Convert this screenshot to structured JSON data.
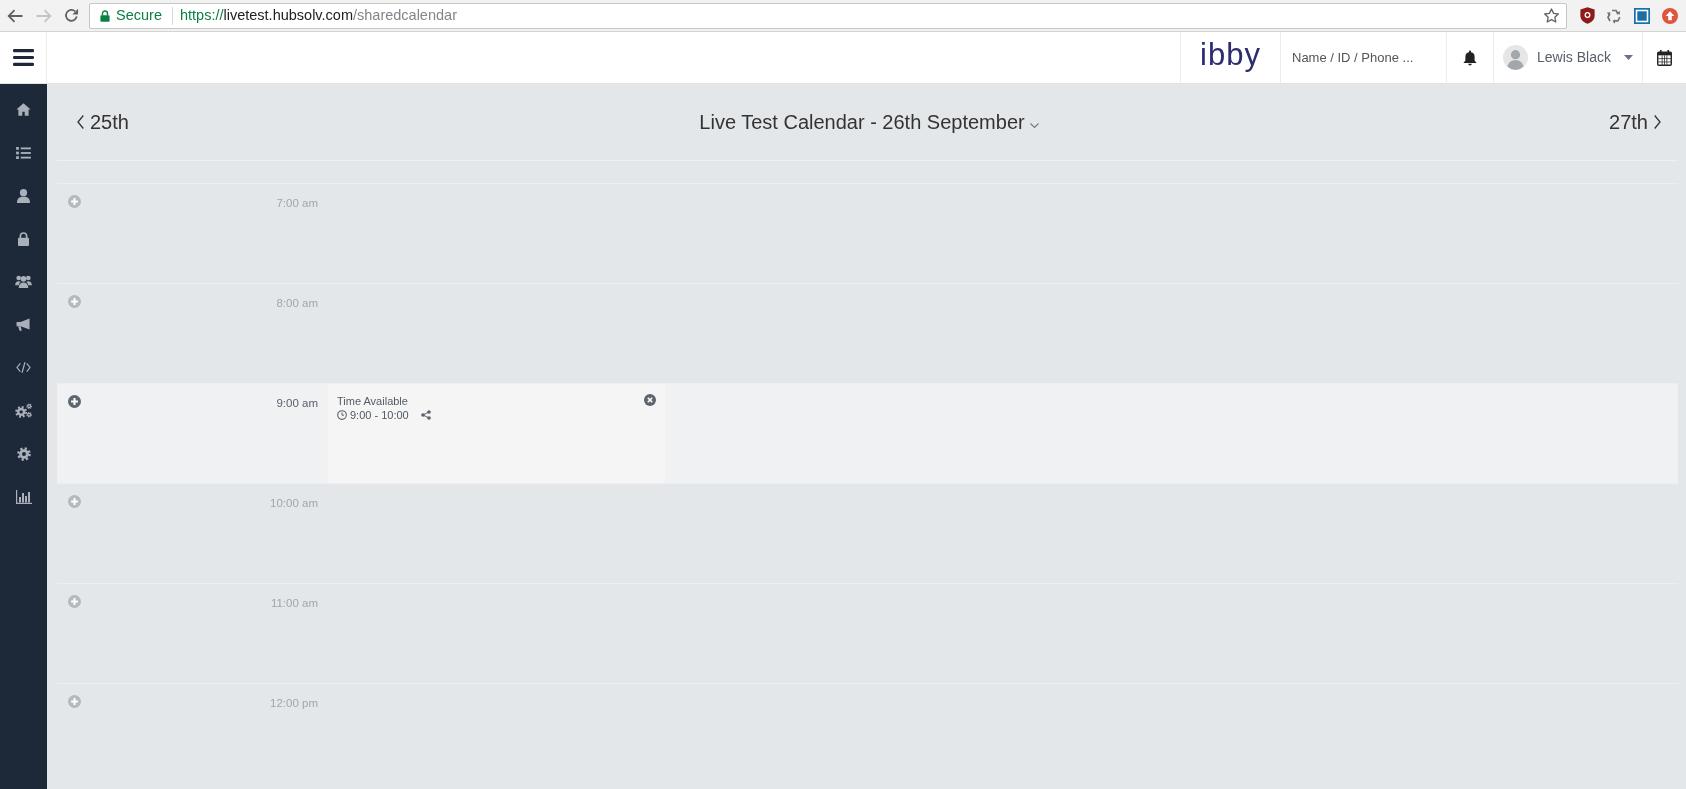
{
  "browser": {
    "back_disabled": false,
    "forward_disabled": true,
    "secure_label": "Secure",
    "url": {
      "scheme": "https://",
      "host": "livetest.hubsolv.com",
      "path": "/sharedcalendar"
    }
  },
  "header": {
    "logo": "ibby",
    "search": {
      "placeholder": "Name / ID / Phone ..."
    },
    "user": {
      "name": "Lewis Black"
    }
  },
  "calendar": {
    "prev_day": "25th",
    "title": "Live Test Calendar - 26th September",
    "next_day": "27th",
    "slots": [
      {
        "time": "7:00 am",
        "selected": false
      },
      {
        "time": "8:00 am",
        "selected": false
      },
      {
        "time": "9:00 am",
        "selected": true,
        "events": [
          {
            "title": "Time Available",
            "time_range": "9:00 - 10:00"
          }
        ]
      },
      {
        "time": "10:00 am",
        "selected": false
      },
      {
        "time": "11:00 am",
        "selected": false
      },
      {
        "time": "12:00 pm",
        "selected": false
      }
    ]
  }
}
